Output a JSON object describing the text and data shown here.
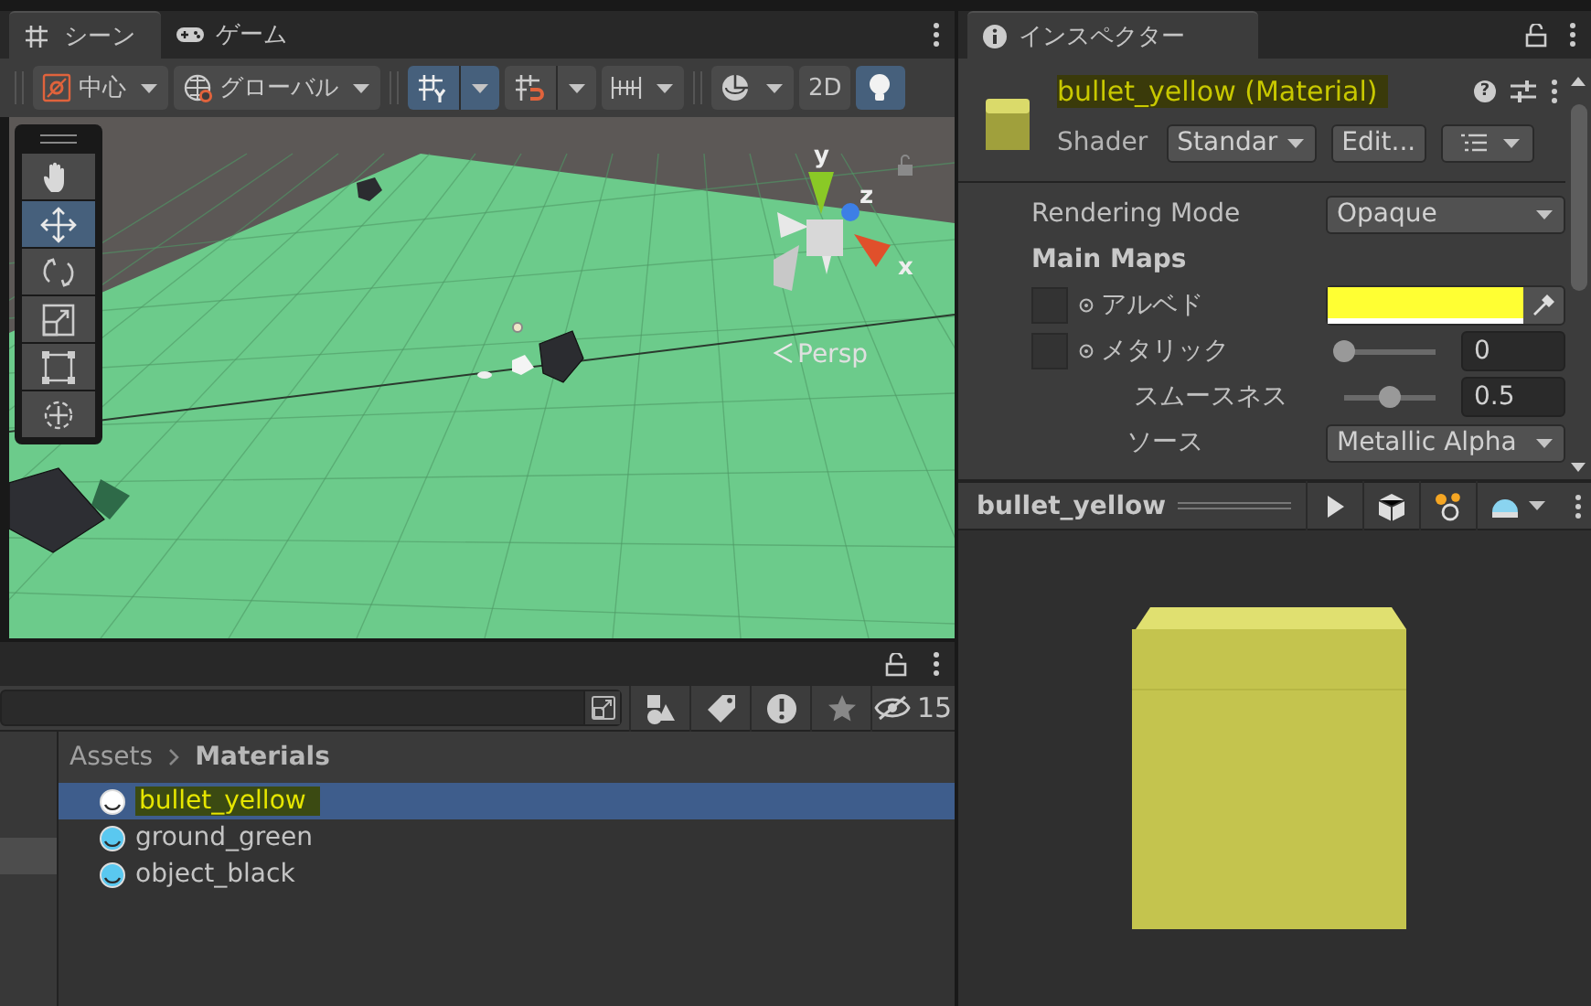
{
  "scene_panel": {
    "tabs": [
      {
        "label": "シーン",
        "kind": "scene",
        "selected": true
      },
      {
        "label": "ゲーム",
        "kind": "game",
        "selected": false
      }
    ],
    "toolbar": [
      {
        "kind": "pivot",
        "label": "中心",
        "on": false
      },
      {
        "kind": "space",
        "label": "グローバル",
        "on": false
      },
      {
        "kind": "grid",
        "on": true
      },
      {
        "kind": "snap",
        "on": false
      },
      {
        "kind": "increment",
        "on": false
      },
      {
        "kind": "draw",
        "on": false
      },
      {
        "kind": "mode",
        "label": "2D",
        "on": false
      },
      {
        "kind": "light",
        "on": true
      }
    ],
    "tools": [
      {
        "kind": "hand",
        "selected": false
      },
      {
        "kind": "move",
        "selected": true
      },
      {
        "kind": "rotate",
        "selected": false
      },
      {
        "kind": "scale",
        "selected": false
      },
      {
        "kind": "rect",
        "selected": false
      },
      {
        "kind": "transform",
        "selected": false
      }
    ],
    "gizmo": {
      "axes": [
        "y",
        "z",
        "x"
      ],
      "projection": "Persp"
    }
  },
  "project_panel": {
    "hidden_count": "15",
    "breadcrumb": [
      "Assets",
      "Materials"
    ],
    "items": [
      {
        "name": "bullet_yellow",
        "selected": true
      },
      {
        "name": "ground_green",
        "selected": false
      },
      {
        "name": "object_black",
        "selected": false
      }
    ]
  },
  "inspector": {
    "tab": "インスペクター",
    "title": "bullet_yellow (Material)",
    "help_glyph": "?",
    "shader_label": "Shader",
    "shader": "Standar",
    "edit_button": "Edit...",
    "properties": [
      {
        "kind": "dropdown",
        "label": "Rendering Mode",
        "value": "Opaque"
      },
      {
        "kind": "header",
        "label": "Main Maps"
      },
      {
        "kind": "color",
        "label": "アルベド",
        "color": "#ffff33"
      },
      {
        "kind": "slider",
        "label": "メタリック",
        "slot": true,
        "level": 0,
        "value": "0"
      },
      {
        "kind": "slider",
        "label": "スムースネス",
        "slot": false,
        "level": 0.5,
        "value": "0.5"
      },
      {
        "kind": "dropdown",
        "label": "ソース",
        "value": "Metallic Alpha"
      }
    ],
    "preview": {
      "title": "bullet_yellow"
    }
  }
}
